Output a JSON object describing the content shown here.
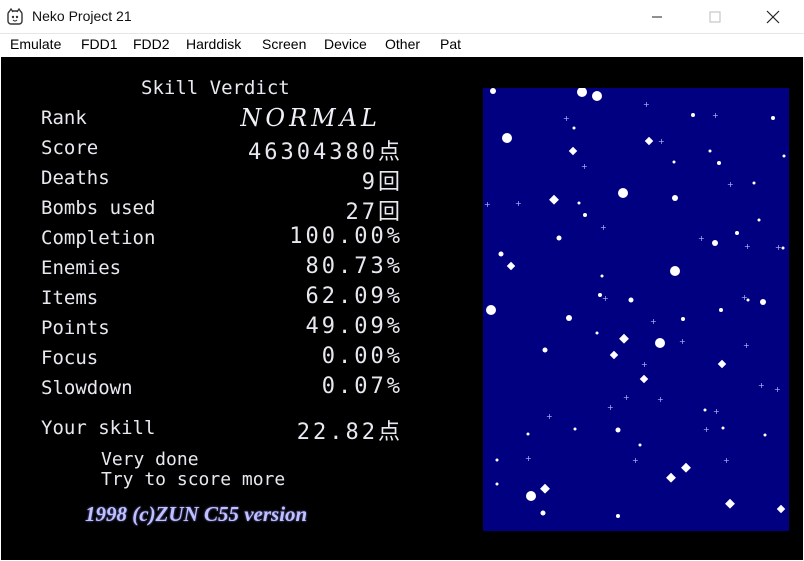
{
  "window": {
    "title": "Neko Project 21"
  },
  "menu": [
    "Emulate",
    "FDD1",
    "FDD2",
    "Harddisk",
    "Screen",
    "Device",
    "Other",
    "Pat"
  ],
  "verdict": {
    "heading": "Skill Verdict",
    "rows": [
      {
        "label": "Rank",
        "value": "NORMAL"
      },
      {
        "label": "Score",
        "value": "46304380点"
      },
      {
        "label": "Deaths",
        "value": "9回"
      },
      {
        "label": "Bombs used",
        "value": "27回"
      },
      {
        "label": "Completion",
        "value": "100.00%"
      },
      {
        "label": "Enemies",
        "value": "80.73%"
      },
      {
        "label": "Items",
        "value": "62.09%"
      },
      {
        "label": "Points",
        "value": "49.09%"
      },
      {
        "label": "Focus",
        "value": "0.00%"
      },
      {
        "label": "Slowdown",
        "value": "0.07%"
      }
    ],
    "skill_label": "Your skill",
    "skill_value": "22.82点",
    "comment_line1": "Very done",
    "comment_line2": "Try to score more",
    "credit": "1998 (c)ZUN C55 version"
  },
  "colors": {
    "stage_bg": "#000080",
    "text": "#e8e8f0",
    "credit": "#c0c0ff"
  }
}
